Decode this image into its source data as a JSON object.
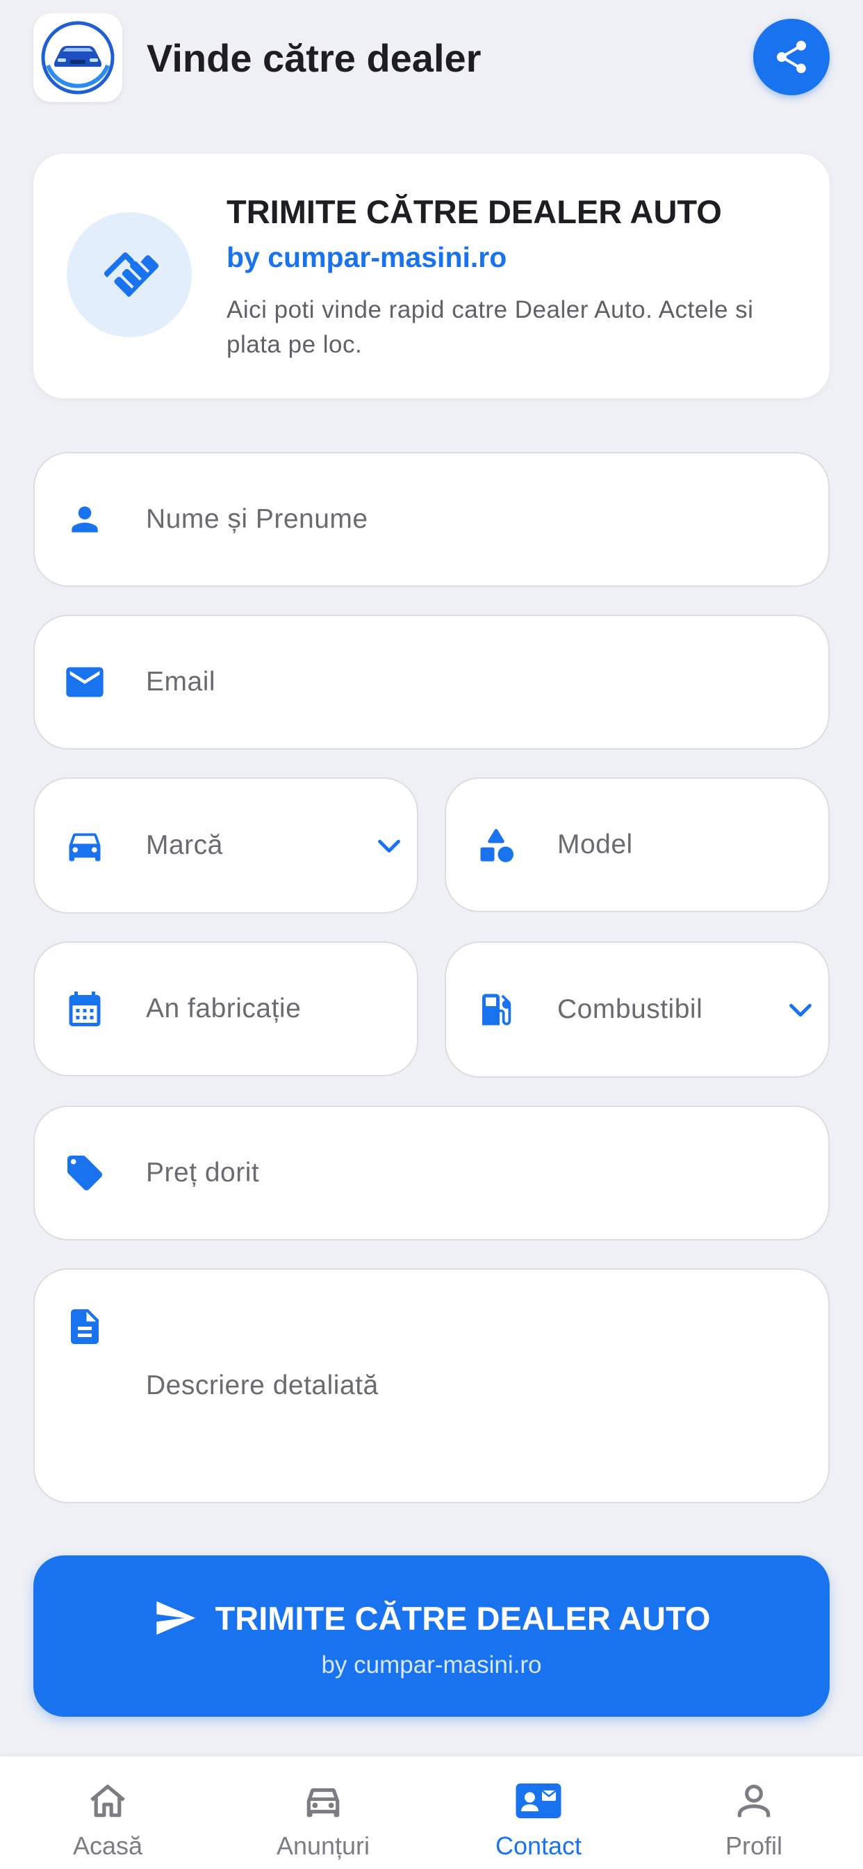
{
  "header": {
    "title": "Vinde către dealer",
    "logo_icon": "car-logo-icon",
    "share_icon": "share-icon"
  },
  "info_card": {
    "icon": "handshake-icon",
    "title": "TRIMITE CĂTRE DEALER AUTO",
    "subtitle": "by cumpar-masini.ro",
    "description": "Aici poti vinde rapid catre Dealer Auto. Actele si plata pe loc."
  },
  "form": {
    "name": {
      "icon": "person-icon",
      "placeholder": "Nume și Prenume"
    },
    "email": {
      "icon": "mail-icon",
      "placeholder": "Email"
    },
    "brand": {
      "icon": "car-icon",
      "placeholder": "Marcă",
      "dropdown": true
    },
    "model": {
      "icon": "shapes-icon",
      "placeholder": "Model"
    },
    "year": {
      "icon": "calendar-icon",
      "placeholder": "An fabricație"
    },
    "fuel": {
      "icon": "fuel-pump-icon",
      "placeholder": "Combustibil",
      "dropdown": true
    },
    "price": {
      "icon": "tag-icon",
      "placeholder": "Preț dorit"
    },
    "description": {
      "icon": "document-icon",
      "placeholder": "Descriere detaliată"
    }
  },
  "submit": {
    "icon": "send-icon",
    "label": "TRIMITE CĂTRE DEALER AUTO",
    "sublabel": "by cumpar-masini.ro"
  },
  "bottom_nav": {
    "items": [
      {
        "label": "Acasă",
        "icon": "home-icon",
        "active": false
      },
      {
        "label": "Anunțuri",
        "icon": "car-icon",
        "active": false
      },
      {
        "label": "Contact",
        "icon": "contact-card-icon",
        "active": true
      },
      {
        "label": "Profil",
        "icon": "person-outline-icon",
        "active": false
      }
    ]
  },
  "colors": {
    "accent": "#1a73ee",
    "background": "#eff0f5",
    "card": "#ffffff",
    "muted_text": "#6a6b72",
    "nav_inactive": "#7b7c84"
  }
}
